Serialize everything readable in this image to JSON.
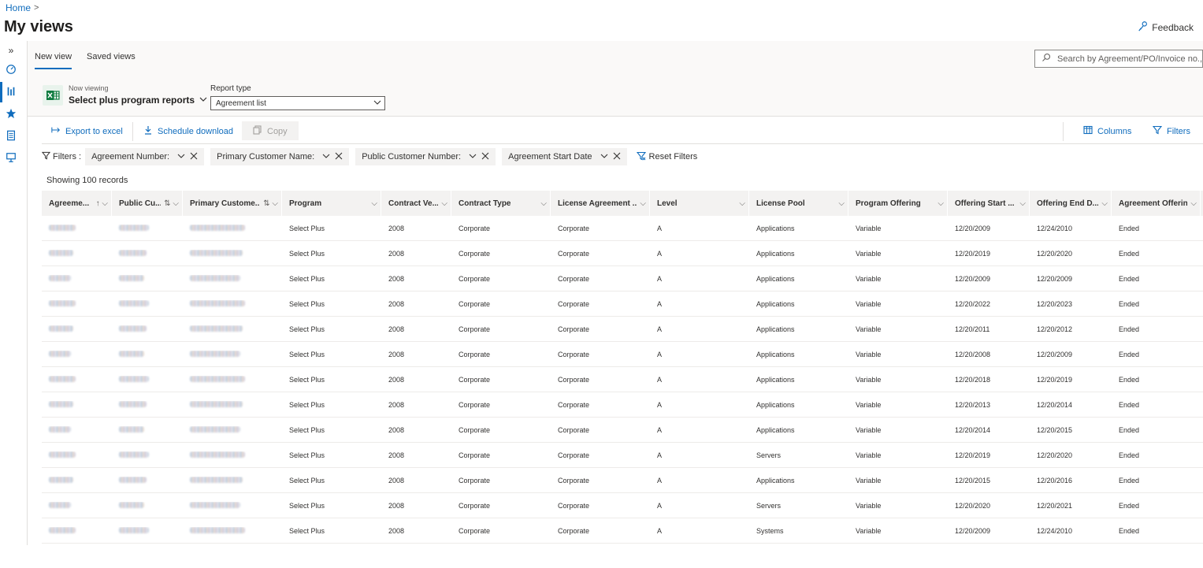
{
  "breadcrumb": {
    "home": "Home",
    "sep": ">"
  },
  "page": {
    "title": "My views",
    "feedback": "Feedback"
  },
  "rail": {
    "collapse": "»"
  },
  "tabs": [
    {
      "label": "New view"
    },
    {
      "label": "Saved views"
    }
  ],
  "search": {
    "placeholder": "Search by Agreement/PO/Invoice no., ..."
  },
  "view": {
    "now_viewing_label": "Now viewing",
    "now_viewing_value": "Select plus program reports",
    "report_type_label": "Report type",
    "report_type_value": "Agreement list"
  },
  "toolbar": {
    "export": "Export to excel",
    "schedule": "Schedule download",
    "copy": "Copy",
    "columns": "Columns",
    "filters": "Filters"
  },
  "filters": {
    "label": "Filters :",
    "chips": [
      "Agreement Number:",
      "Primary Customer Name:",
      "Public Customer Number:",
      "Agreement Start Date"
    ],
    "reset": "Reset Filters"
  },
  "records_text": "Showing 100 records",
  "table": {
    "columns": [
      {
        "label": "Agreeme...",
        "icon": "↑ ⌵"
      },
      {
        "label": "Public Cu...",
        "icon": "⇅ ⌵"
      },
      {
        "label": "Primary Custome...",
        "icon": "⇅ ⌵"
      },
      {
        "label": "Program",
        "icon": "⌵"
      },
      {
        "label": "Contract Ve...",
        "icon": "⌵"
      },
      {
        "label": "Contract Type",
        "icon": "⌵"
      },
      {
        "label": "License Agreement ...",
        "icon": "⌵"
      },
      {
        "label": "Level",
        "icon": "⌵"
      },
      {
        "label": "License Pool",
        "icon": "⌵"
      },
      {
        "label": "Program Offering",
        "icon": "⌵"
      },
      {
        "label": "Offering Start ...",
        "icon": "⌵"
      },
      {
        "label": "Offering End D...",
        "icon": "⌵"
      },
      {
        "label": "Agreement Offering...",
        "icon": "⌵"
      }
    ],
    "rows": [
      [
        "Select Plus",
        "2008",
        "Corporate",
        "Corporate",
        "A",
        "Applications",
        "Variable",
        "12/20/2009",
        "12/24/2010",
        "Ended"
      ],
      [
        "Select Plus",
        "2008",
        "Corporate",
        "Corporate",
        "A",
        "Applications",
        "Variable",
        "12/20/2019",
        "12/20/2020",
        "Ended"
      ],
      [
        "Select Plus",
        "2008",
        "Corporate",
        "Corporate",
        "A",
        "Applications",
        "Variable",
        "12/20/2009",
        "12/20/2009",
        "Ended"
      ],
      [
        "Select Plus",
        "2008",
        "Corporate",
        "Corporate",
        "A",
        "Applications",
        "Variable",
        "12/20/2022",
        "12/20/2023",
        "Ended"
      ],
      [
        "Select Plus",
        "2008",
        "Corporate",
        "Corporate",
        "A",
        "Applications",
        "Variable",
        "12/20/2011",
        "12/20/2012",
        "Ended"
      ],
      [
        "Select Plus",
        "2008",
        "Corporate",
        "Corporate",
        "A",
        "Applications",
        "Variable",
        "12/20/2008",
        "12/20/2009",
        "Ended"
      ],
      [
        "Select Plus",
        "2008",
        "Corporate",
        "Corporate",
        "A",
        "Applications",
        "Variable",
        "12/20/2018",
        "12/20/2019",
        "Ended"
      ],
      [
        "Select Plus",
        "2008",
        "Corporate",
        "Corporate",
        "A",
        "Applications",
        "Variable",
        "12/20/2013",
        "12/20/2014",
        "Ended"
      ],
      [
        "Select Plus",
        "2008",
        "Corporate",
        "Corporate",
        "A",
        "Applications",
        "Variable",
        "12/20/2014",
        "12/20/2015",
        "Ended"
      ],
      [
        "Select Plus",
        "2008",
        "Corporate",
        "Corporate",
        "A",
        "Servers",
        "Variable",
        "12/20/2019",
        "12/20/2020",
        "Ended"
      ],
      [
        "Select Plus",
        "2008",
        "Corporate",
        "Corporate",
        "A",
        "Applications",
        "Variable",
        "12/20/2015",
        "12/20/2016",
        "Ended"
      ],
      [
        "Select Plus",
        "2008",
        "Corporate",
        "Corporate",
        "A",
        "Servers",
        "Variable",
        "12/20/2020",
        "12/20/2021",
        "Ended"
      ],
      [
        "Select Plus",
        "2008",
        "Corporate",
        "Corporate",
        "A",
        "Systems",
        "Variable",
        "12/20/2009",
        "12/24/2010",
        "Ended"
      ]
    ]
  }
}
